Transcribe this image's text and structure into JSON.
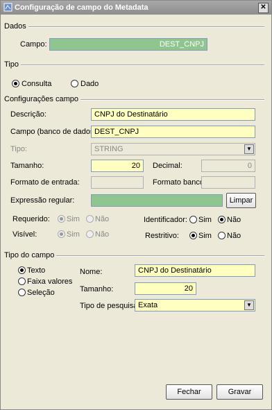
{
  "window": {
    "title": "Configuração de campo do Metadata",
    "close": "✕"
  },
  "dados": {
    "title": "Dados",
    "campo_label": "Campo:",
    "campo_value": "DEST_CNPJ"
  },
  "tipo": {
    "title": "Tipo",
    "options": [
      "Consulta",
      "Dado"
    ],
    "selected": "Consulta"
  },
  "config": {
    "title": "Configurações campo",
    "descricao_label": "Descrição:",
    "descricao_value": "CNPJ do Destinatário",
    "campo_bd_label": "Campo (banco de dados):",
    "campo_bd_value": "DEST_CNPJ",
    "tipo_label": "Tipo:",
    "tipo_value": "STRING",
    "tamanho_label": "Tamanho:",
    "tamanho_value": "20",
    "decimal_label": "Decimal:",
    "decimal_value": "0",
    "formato_entrada_label": "Formato de entrada:",
    "formato_entrada_value": "",
    "formato_banco_label": "Formato banco:",
    "formato_banco_value": "",
    "expressao_label": "Expressão regular:",
    "expressao_value": "",
    "limpar_label": "Limpar",
    "requerido_label": "Requerido:",
    "visivel_label": "Visível:",
    "identificador_label": "Identificador:",
    "restritivo_label": "Restritivo:",
    "sim": "Sim",
    "nao": "Não"
  },
  "tipo_campo": {
    "title": "Tipo do campo",
    "options": [
      "Texto",
      "Faixa valores",
      "Seleção"
    ],
    "nome_label": "Nome:",
    "nome_value": "CNPJ do Destinatário",
    "tamanho_label": "Tamanho:",
    "tamanho_value": "20",
    "pesquisa_label": "Tipo de pesquisa:",
    "pesquisa_value": "Exata"
  },
  "buttons": {
    "fechar": "Fechar",
    "gravar": "Gravar"
  }
}
